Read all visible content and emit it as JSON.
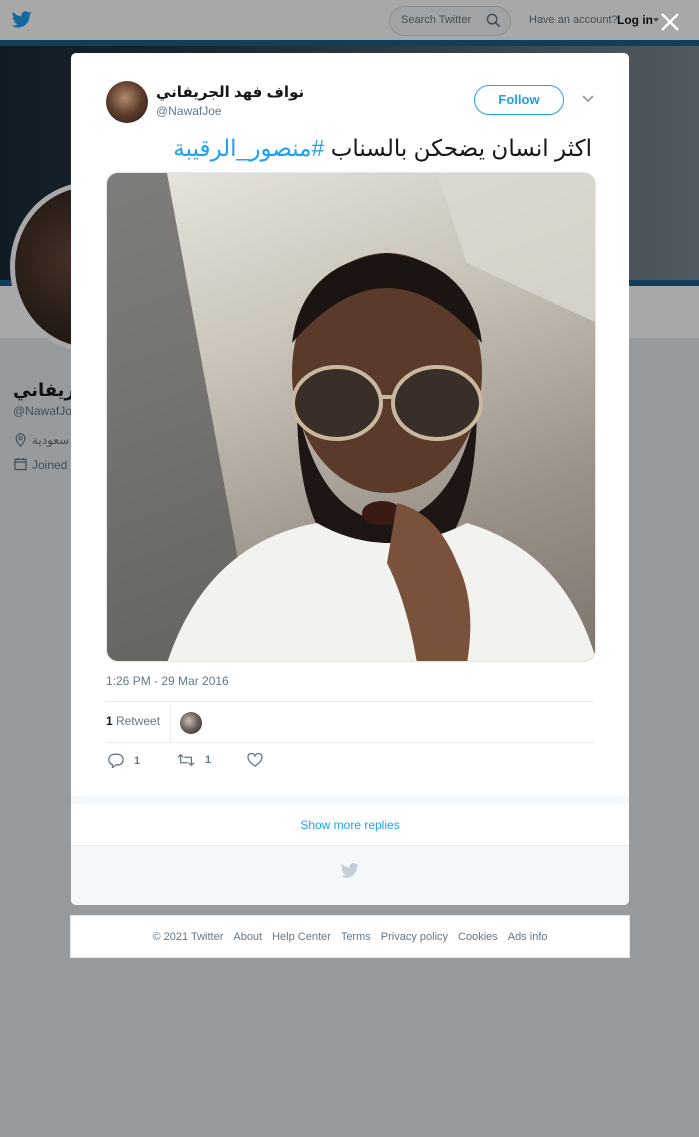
{
  "topbar": {
    "search_placeholder": "Search Twitter",
    "account_prompt": "Have an account?",
    "login_label": "Log in"
  },
  "profile": {
    "name_visible": "جريفاني",
    "handle_visible": "@NawafJoe",
    "location_visible": "سعودية",
    "joined_visible": "Joined"
  },
  "tweet": {
    "author_name": "نواف فهد الجريفاني",
    "author_handle": "@NawafJoe",
    "follow_label": "Follow",
    "text_main": "اكثر انسان يضحكن بالسناب",
    "hashtag": "#منصور_الرقيبة",
    "timestamp": "1:26 PM - 29 Mar 2016",
    "retweet_count": "1",
    "retweet_label": "Retweet",
    "reply_count": "1",
    "retweet_action_count": "1"
  },
  "show_more_replies": "Show more replies",
  "footer": {
    "links": [
      "© 2021 Twitter",
      "About",
      "Help Center",
      "Terms",
      "Privacy policy",
      "Cookies",
      "Ads info"
    ]
  },
  "colors": {
    "brand": "#1da1f2",
    "text_primary": "#14171a",
    "text_secondary": "#657786"
  },
  "icons": {
    "brand_logo": "twitter-bird-icon",
    "search": "search-icon",
    "close": "close-icon",
    "more": "chevron-down-icon",
    "reply": "reply-icon",
    "retweet": "retweet-icon",
    "like": "heart-icon",
    "location": "location-pin-icon",
    "calendar": "calendar-icon"
  }
}
